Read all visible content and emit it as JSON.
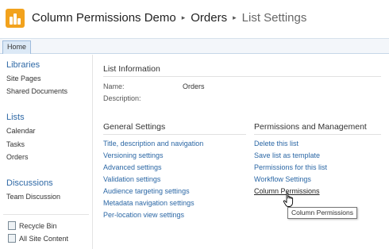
{
  "header": {
    "site_title": "Column Permissions Demo",
    "list_name": "Orders",
    "page_name": "List Settings",
    "separator": "▸"
  },
  "ribbon": {
    "home_tab": "Home"
  },
  "sidebar": {
    "libraries": {
      "heading": "Libraries",
      "items": [
        "Site Pages",
        "Shared Documents"
      ]
    },
    "lists": {
      "heading": "Lists",
      "items": [
        "Calendar",
        "Tasks",
        "Orders"
      ]
    },
    "discussions": {
      "heading": "Discussions",
      "items": [
        "Team Discussion"
      ]
    },
    "footer": {
      "recycle_bin": "Recycle Bin",
      "all_site_content": "All Site Content"
    }
  },
  "list_info": {
    "title": "List Information",
    "name_label": "Name:",
    "name_value": "Orders",
    "description_label": "Description:"
  },
  "general_settings": {
    "title": "General Settings",
    "links": [
      "Title, description and navigation",
      "Versioning settings",
      "Advanced settings",
      "Validation settings",
      "Audience targeting settings",
      "Metadata navigation settings",
      "Per-location view settings"
    ]
  },
  "permissions": {
    "title": "Permissions and Management",
    "links": [
      "Delete this list",
      "Save list as template",
      "Permissions for this list",
      "Workflow Settings",
      "Column Permissions"
    ]
  },
  "tooltip": {
    "text": "Column Permissions"
  }
}
